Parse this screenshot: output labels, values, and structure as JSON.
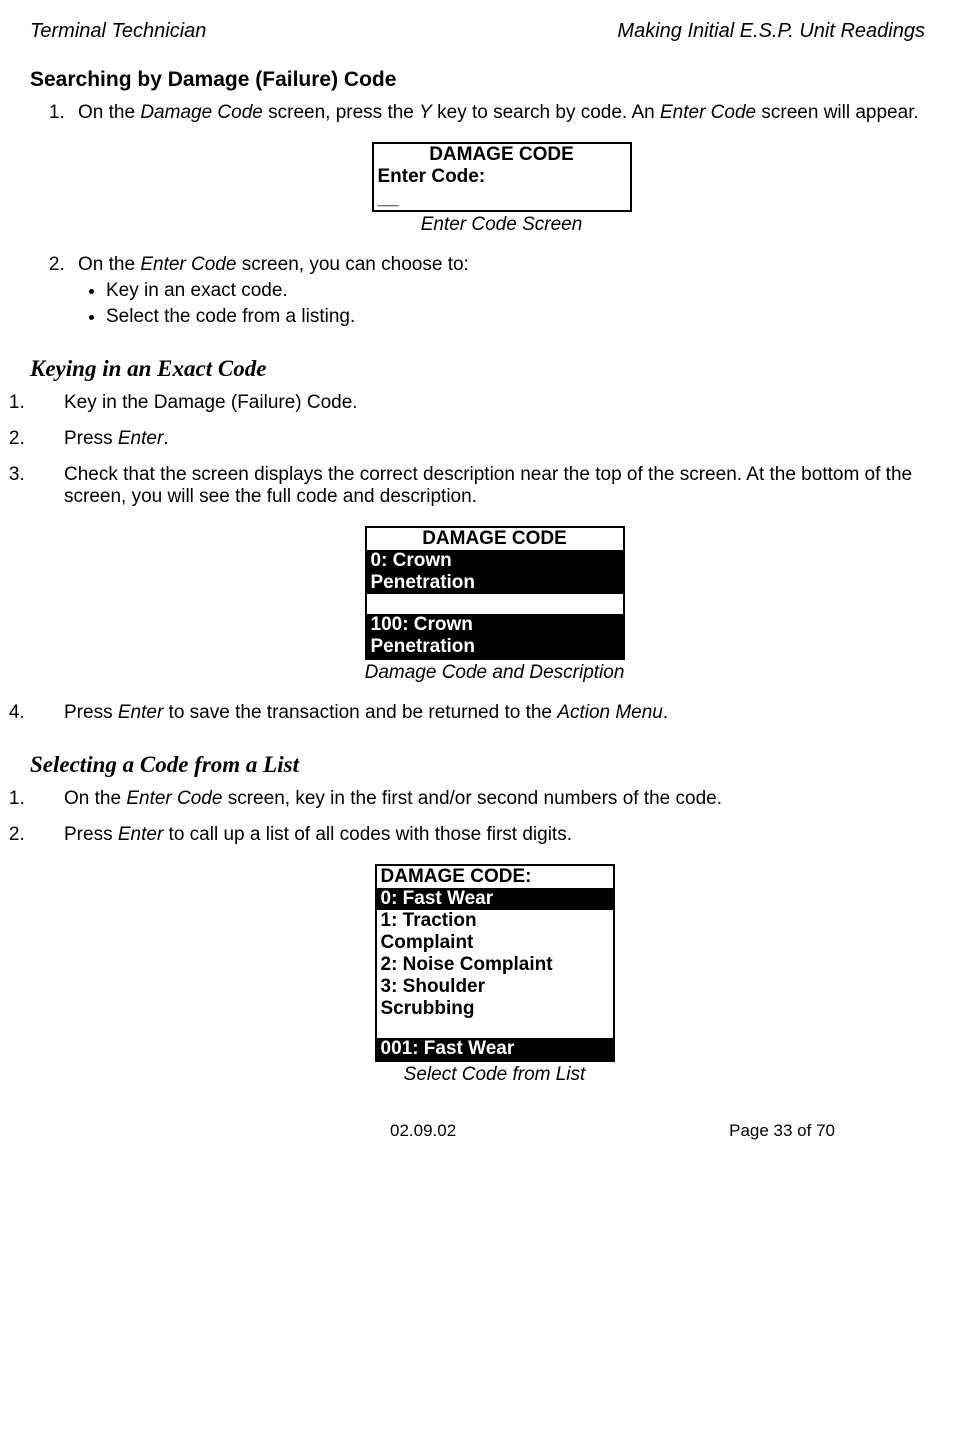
{
  "header": {
    "left": "Terminal Technician",
    "right": "Making Initial E.S.P. Unit Readings"
  },
  "sectionTitle": "Searching by Damage (Failure) Code",
  "step1": {
    "prefix": "On the ",
    "screen1": "Damage Code",
    "mid": " screen, press the ",
    "key": "Y",
    "mid2": " key to search by code.  An ",
    "screen2": "Enter Code",
    "suffix": " screen will appear."
  },
  "box1": {
    "title": "DAMAGE CODE",
    "line1": "Enter Code:",
    "line2": "__",
    "caption": "Enter Code Screen"
  },
  "step2": {
    "prefix": "On the ",
    "screen": "Enter Code",
    "suffix": " screen, you can choose to:",
    "bullets": [
      "Key in an exact code.",
      "Select the code from a listing."
    ]
  },
  "subsec1Title": "Keying in an Exact Code",
  "sub1_1": "Key in the Damage (Failure) Code.",
  "sub1_2": {
    "pre": "Press ",
    "em": "Enter",
    "post": "."
  },
  "sub1_3": "Check that the screen displays the correct description near the top of the screen.  At the bottom of the screen, you will see the full code and description.",
  "box2": {
    "title": "DAMAGE CODE",
    "inv1a": "0: Crown",
    "inv1b": "Penetration",
    "inv2a": "100: Crown",
    "inv2b": "Penetration",
    "caption": "Damage Code and Description"
  },
  "sub1_4": {
    "pre": "Press ",
    "em": "Enter",
    "mid": " to save the transaction and be returned to the ",
    "em2": "Action Menu",
    "post": "."
  },
  "subsec2Title": "Selecting a Code from a List",
  "sub2_1": {
    "pre": "On the ",
    "em": "Enter Code",
    "post": " screen, key in the first and/or second numbers of the code."
  },
  "sub2_2": {
    "pre": "Press ",
    "em": "Enter",
    "post": " to call up a list of all codes with those first digits."
  },
  "box3": {
    "title": "DAMAGE CODE:",
    "inv1": "0: Fast Wear",
    "l1": "1: Traction",
    "l2": "Complaint",
    "l3": "2: Noise Complaint",
    "l4": "3: Shoulder",
    "l5": "Scrubbing",
    "inv2": "001: Fast Wear",
    "caption": "Select Code from List"
  },
  "footer": {
    "date": "02.09.02",
    "page": "Page 33 of 70"
  }
}
